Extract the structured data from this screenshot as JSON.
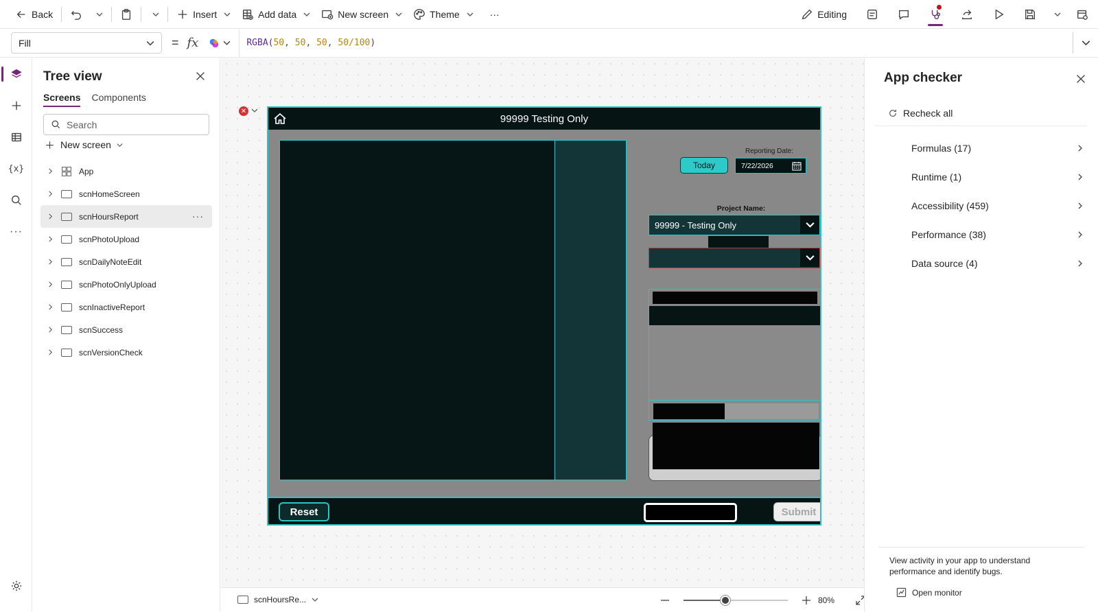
{
  "toolbar": {
    "back": "Back",
    "insert": "Insert",
    "add_data": "Add data",
    "new_screen": "New screen",
    "theme": "Theme",
    "more": "···",
    "editing": "Editing"
  },
  "formula_bar": {
    "property": "Fill",
    "equals": "=",
    "fx": "fx",
    "formula_fn": "RGBA(",
    "formula_args": [
      "50",
      "50",
      "50",
      "50/100"
    ],
    "formula_close": ")"
  },
  "tree": {
    "title": "Tree view",
    "tab_screens": "Screens",
    "tab_components": "Components",
    "search_placeholder": "Search",
    "new_screen": "New screen",
    "items": [
      {
        "label": "App"
      },
      {
        "label": "scnHomeScreen"
      },
      {
        "label": "scnHoursReport"
      },
      {
        "label": "scnPhotoUpload"
      },
      {
        "label": "scnDailyNoteEdit"
      },
      {
        "label": "scnPhotoOnlyUpload"
      },
      {
        "label": "scnInactiveReport"
      },
      {
        "label": "scnSuccess"
      },
      {
        "label": "scnVersionCheck"
      }
    ],
    "more": "···"
  },
  "app_screen": {
    "header_title": "99999 Testing Only",
    "today_button": "Today",
    "reporting_date_label": "Reporting Date:",
    "reporting_date_value": "7/22/2026",
    "project_name_label": "Project Name:",
    "project_selected": "99999 - Testing Only",
    "reset_button": "Reset",
    "submit_button": "Submit"
  },
  "status_bar": {
    "screen_name": "scnHoursRe...",
    "zoom": "80%",
    "zoom_fraction": 0.4
  },
  "checker": {
    "title": "App checker",
    "recheck": "Recheck all",
    "items": [
      {
        "label": "Formulas (17)"
      },
      {
        "label": "Runtime (1)"
      },
      {
        "label": "Accessibility (459)"
      },
      {
        "label": "Performance (38)"
      },
      {
        "label": "Data source (4)"
      }
    ],
    "info": "View activity in your app to understand performance and identify bugs.",
    "open_monitor": "Open monitor"
  },
  "colors": {
    "accent": "#742774",
    "app_teal": "#2ec4c4",
    "app_dark": "#071414",
    "error_red": "#d13438"
  }
}
